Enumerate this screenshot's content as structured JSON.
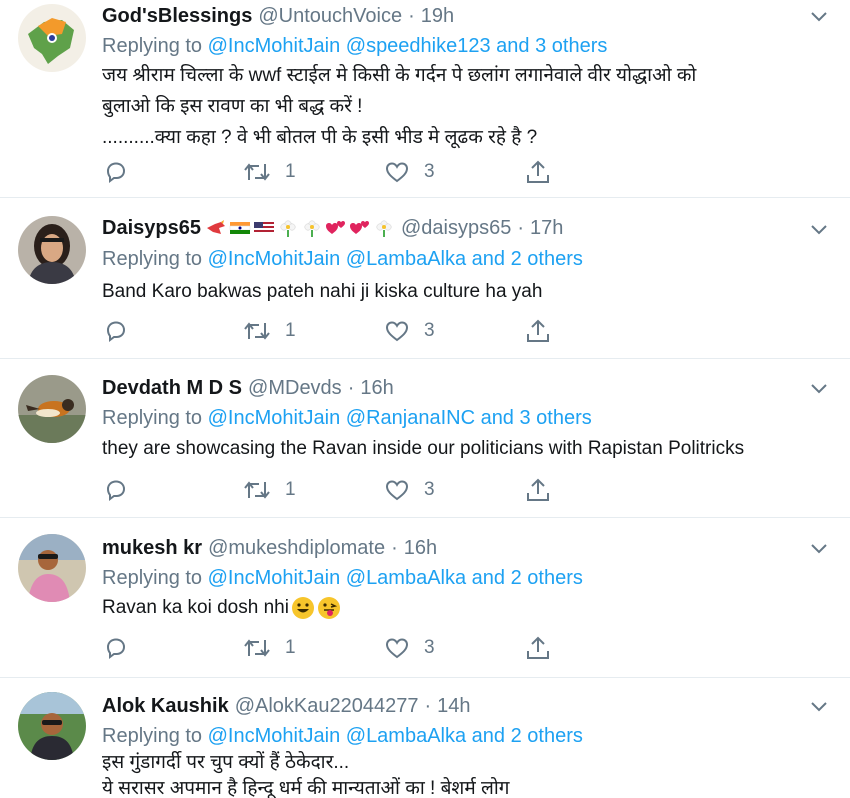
{
  "tweets": [
    {
      "name": "God'sBlessings",
      "handle": "@UntouchVoice",
      "time": "19h",
      "reply_prefix": "Replying to",
      "reply_mentions": "@IncMohitJain @speedhike123 and 3 others",
      "lines": [
        "जय श्रीराम चिल्ला के wwf स्टाईल मे किसी के गर्दन पे छलांग लगानेवाले वीर योद्धाओ को",
        "बुलाओ कि इस रावण का भी बद्ध करें !",
        "..........क्या कहा ? वे भी बोतल पी के इसी भीड मे लूढक रहे है ?"
      ],
      "replies": "",
      "retweets": "1",
      "likes": "3",
      "emojis": []
    },
    {
      "name": "Daisyps65",
      "handle": "@daisyps65",
      "time": "17h",
      "reply_prefix": "Replying to",
      "reply_mentions": "@IncMohitJain @LambaAlka and 2 others",
      "lines": [
        "Band Karo bakwas pateh nahi ji kiska culture ha yah"
      ],
      "replies": "",
      "retweets": "1",
      "likes": "3",
      "emojis": [
        "bird-emoji",
        "india-flag-emoji",
        "us-flag-emoji",
        "flower-emoji",
        "flower-emoji",
        "two-hearts-emoji",
        "two-hearts-emoji",
        "flower-emoji"
      ]
    },
    {
      "name": "Devdath M D S",
      "handle": "@MDevds",
      "time": "16h",
      "reply_prefix": "Replying to",
      "reply_mentions": "@IncMohitJain @RanjanaINC and 3 others",
      "lines": [
        "they are showcasing the Ravan inside our politicians with Rapistan Politricks"
      ],
      "replies": "",
      "retweets": "1",
      "likes": "3",
      "emojis": []
    },
    {
      "name": "mukesh kr",
      "handle": "@mukeshdiplomate",
      "time": "16h",
      "reply_prefix": "Replying to",
      "reply_mentions": "@IncMohitJain @LambaAlka and 2 others",
      "lines": [
        "Ravan ka koi dosh nhi"
      ],
      "replies": "",
      "retweets": "1",
      "likes": "3",
      "emojis": []
    },
    {
      "name": "Alok Kaushik",
      "handle": "@AlokKau22044277",
      "time": "14h",
      "reply_prefix": "Replying to",
      "reply_mentions": "@IncMohitJain @LambaAlka and 2 others",
      "lines": [
        "इस गुंडागर्दी पर चुप क्यों हैं ठेकेदार...",
        "ये सरासर अपमान है हिन्दू धर्म की मान्यताओं का ! बेशर्म लोग"
      ],
      "replies": "",
      "retweets": "",
      "likes": "",
      "emojis": []
    }
  ],
  "colors": {
    "link": "#1da1f2",
    "secondary": "#657786",
    "text": "#14171a",
    "divider": "#e6ecf0"
  },
  "icons": {
    "reply": "reply-icon",
    "retweet": "retweet-icon",
    "like": "heart-icon",
    "share": "share-icon",
    "menu": "chevron-down-icon"
  }
}
